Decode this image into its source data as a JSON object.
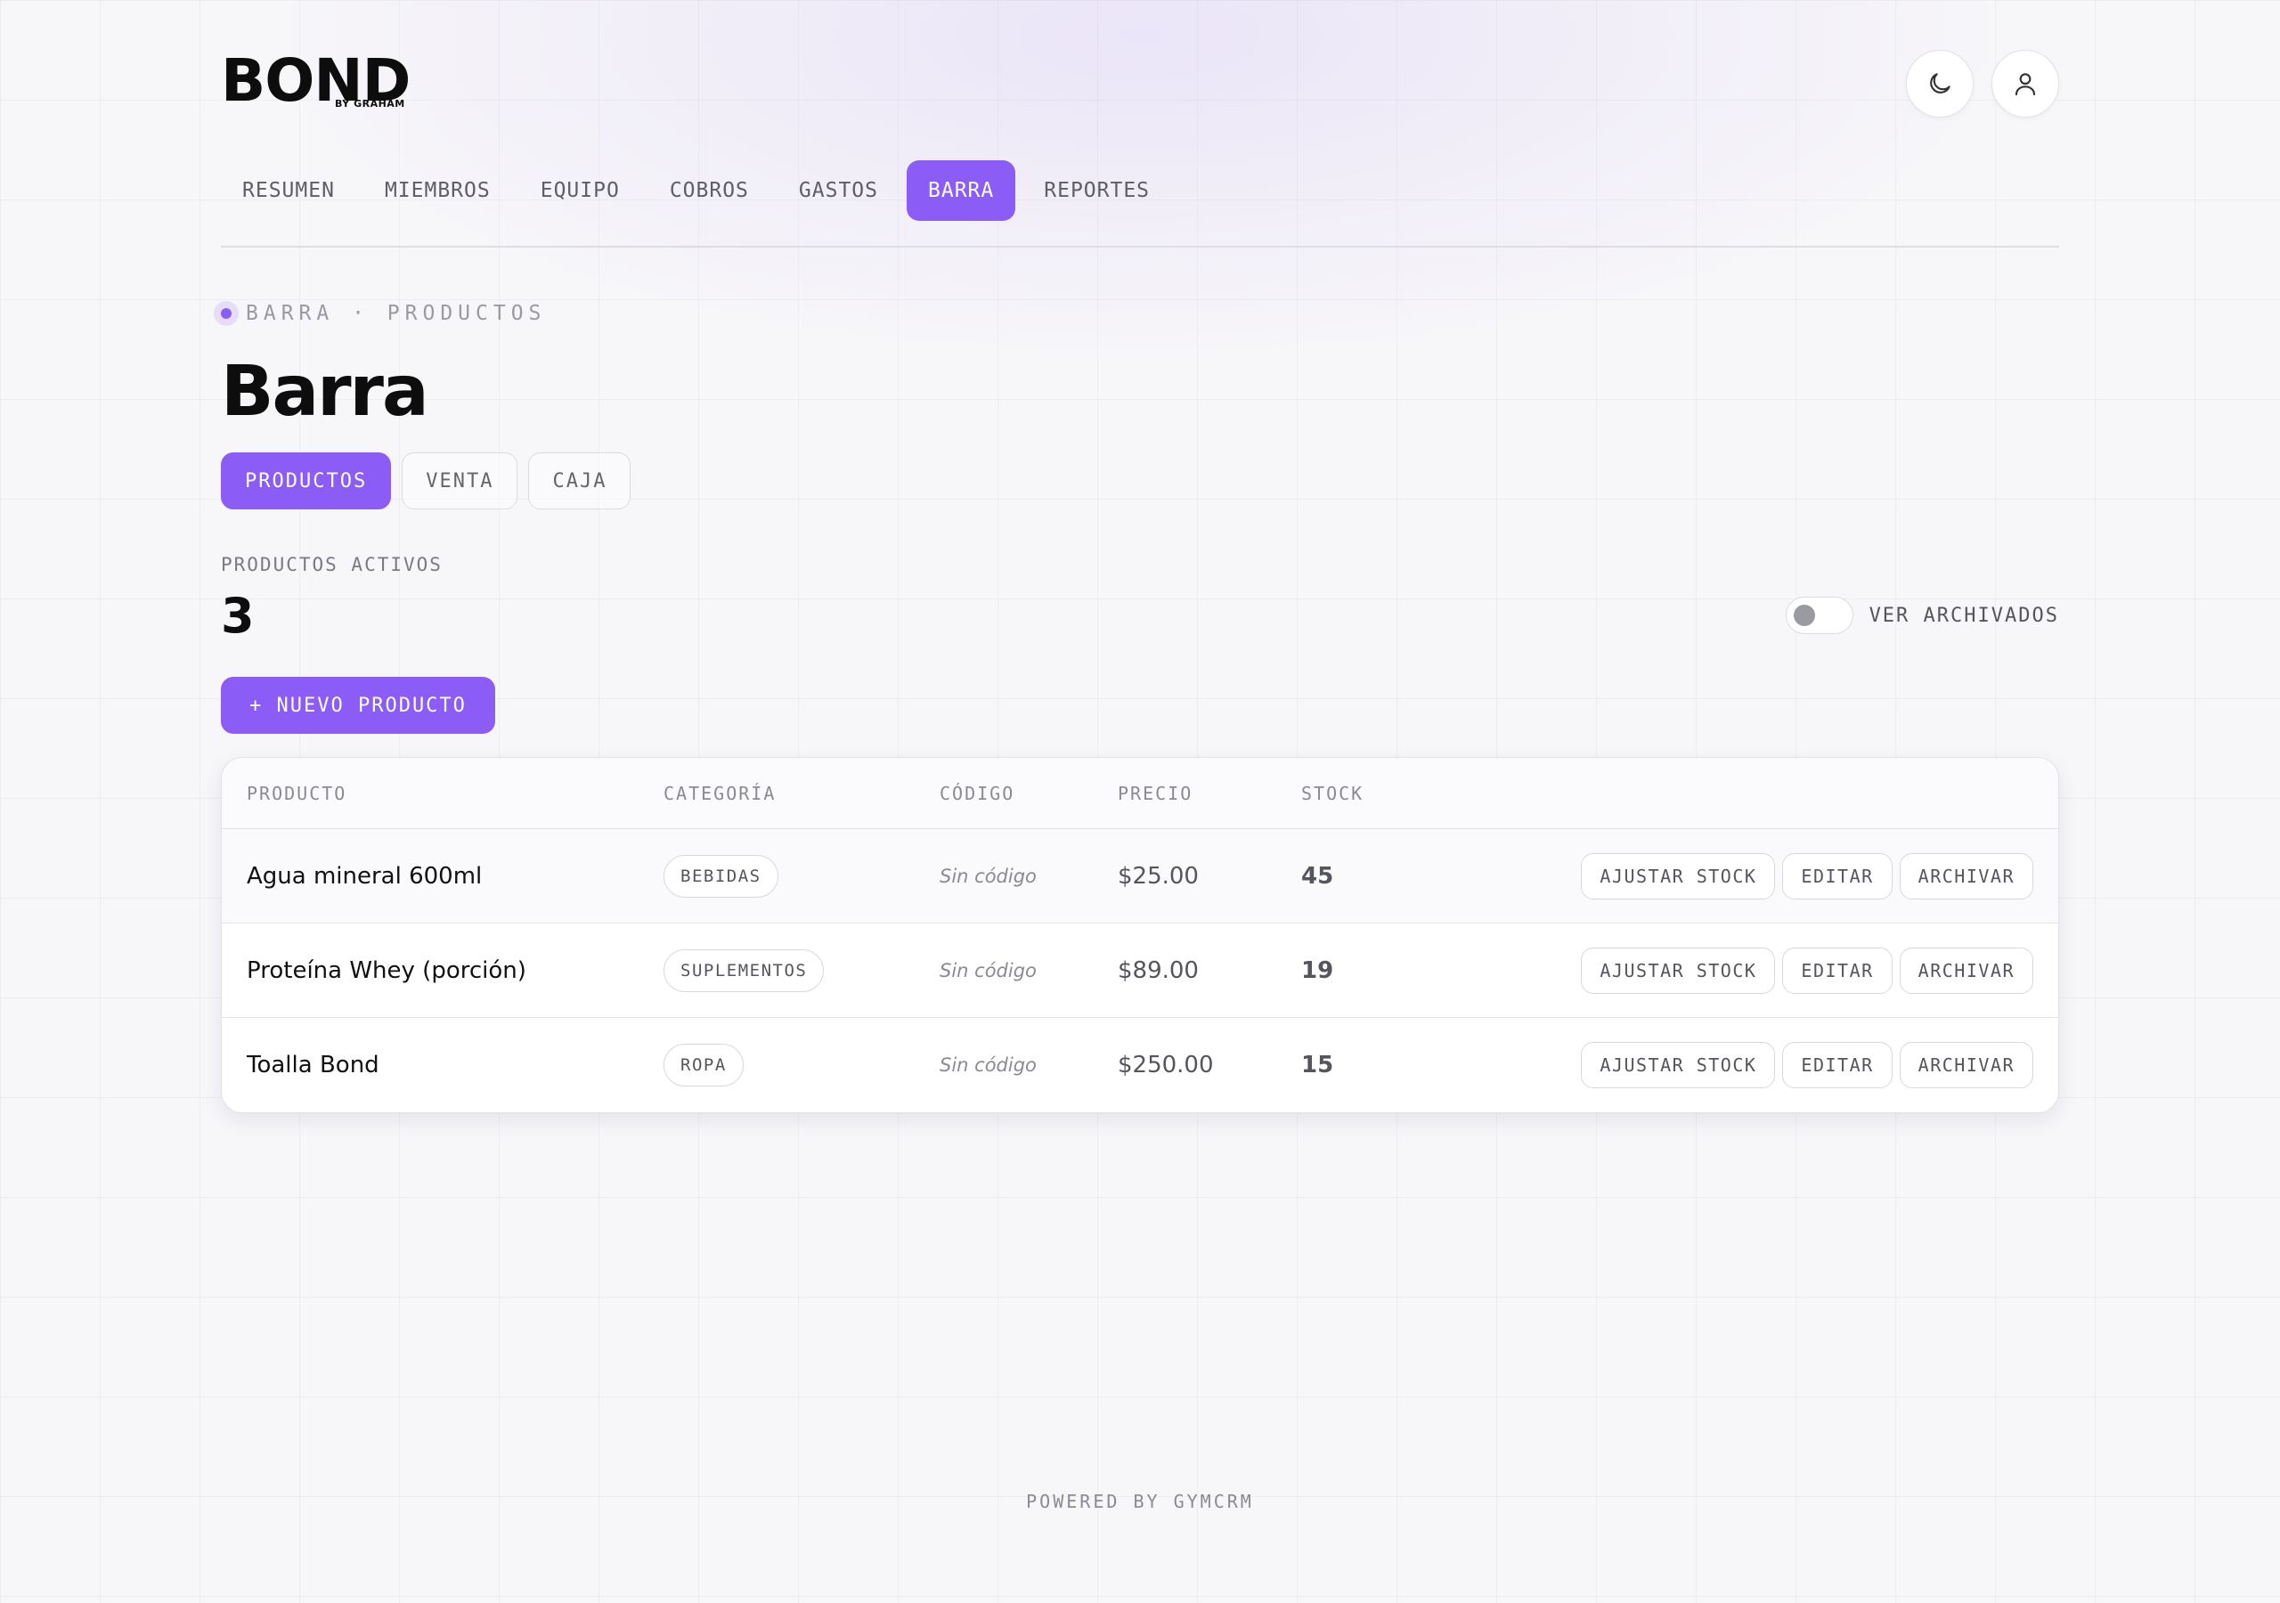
{
  "brand": {
    "name": "BOND",
    "sub": "BY GRAHAM"
  },
  "header": {
    "theme_icon": "moon-icon",
    "user_icon": "user-icon"
  },
  "nav": {
    "items": [
      {
        "label": "RESUMEN"
      },
      {
        "label": "MIEMBROS"
      },
      {
        "label": "EQUIPO"
      },
      {
        "label": "COBROS"
      },
      {
        "label": "GASTOS"
      },
      {
        "label": "BARRA",
        "active": true
      },
      {
        "label": "REPORTES"
      }
    ]
  },
  "breadcrumb": "BARRA · PRODUCTOS",
  "page": {
    "title": "Barra"
  },
  "tabs": [
    {
      "label": "PRODUCTOS",
      "active": true
    },
    {
      "label": "VENTA"
    },
    {
      "label": "CAJA"
    }
  ],
  "stats": {
    "label": "PRODUCTOS ACTIVOS",
    "value": "3"
  },
  "toggle": {
    "label": "VER ARCHIVADOS",
    "checked": false
  },
  "actions": {
    "new_product": "+ NUEVO PRODUCTO"
  },
  "table": {
    "headers": {
      "product": "PRODUCTO",
      "category": "CATEGORÍA",
      "code": "CÓDIGO",
      "price": "PRECIO",
      "stock": "STOCK"
    },
    "rows": [
      {
        "name": "Agua mineral 600ml",
        "category": "BEBIDAS",
        "code": "Sin código",
        "price": "$25.00",
        "stock": "45"
      },
      {
        "name": "Proteína Whey (porción)",
        "category": "SUPLEMENTOS",
        "code": "Sin código",
        "price": "$89.00",
        "stock": "19"
      },
      {
        "name": "Toalla Bond",
        "category": "ROPA",
        "code": "Sin código",
        "price": "$250.00",
        "stock": "15"
      }
    ],
    "row_actions": {
      "adjust": "AJUSTAR STOCK",
      "edit": "EDITAR",
      "archive": "ARCHIVAR"
    }
  },
  "footer": "POWERED BY GYMCRM",
  "colors": {
    "accent": "#8b5cf6"
  }
}
